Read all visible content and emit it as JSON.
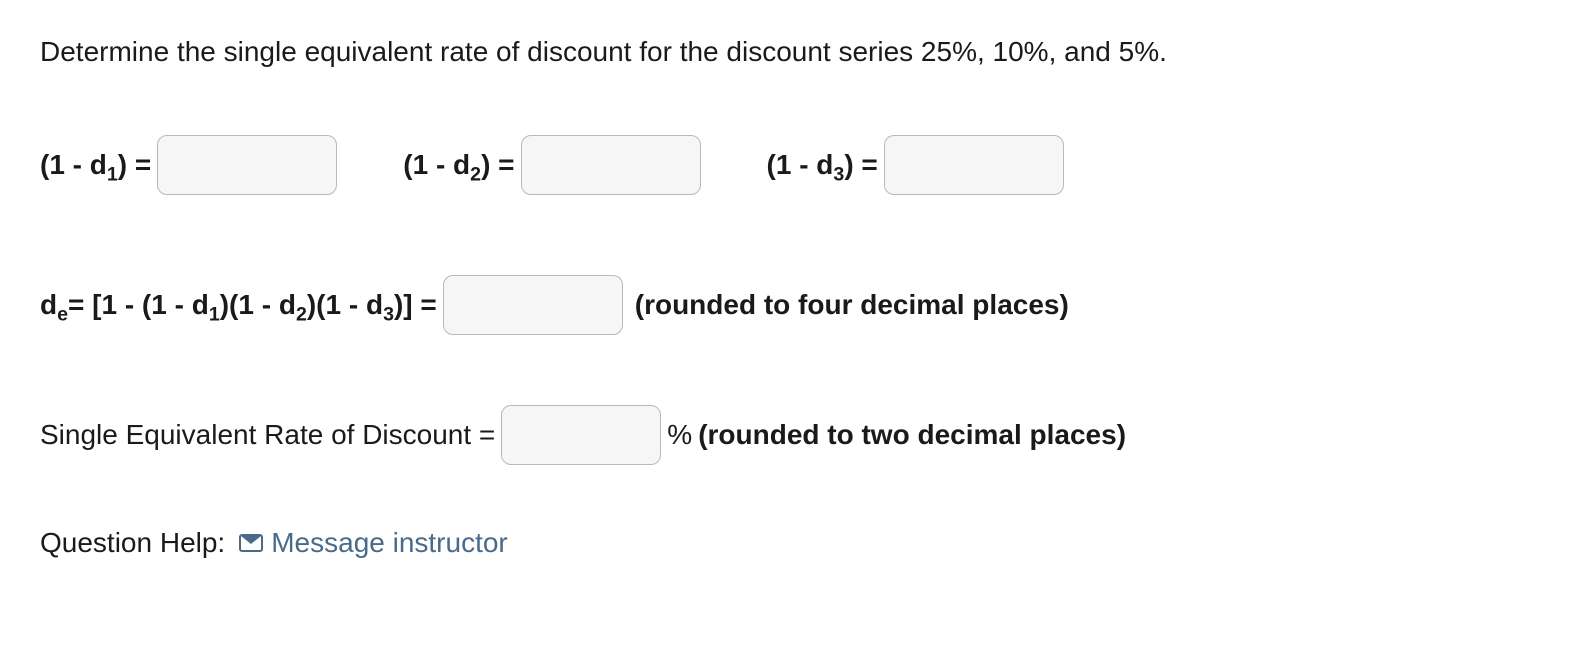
{
  "prompt": "Determine the single equivalent rate of discount for the discount series 25%, 10%, and 5%.",
  "row1": {
    "d1_label_pre": "(1 - d",
    "d1_sub": "1",
    "d1_label_post": ") = ",
    "d2_label_pre": "(1 - d",
    "d2_sub": "2",
    "d2_label_post": ") = ",
    "d3_label_pre": "(1 - d",
    "d3_sub": "3",
    "d3_label_post": ") = "
  },
  "row2": {
    "de_pre": "d",
    "de_sub": "e",
    "de_mid": "= [1 - (1 - d",
    "s1": "1",
    "p1": ")(1 - d",
    "s2": "2",
    "p2": ")(1 - d",
    "s3": "3",
    "p3": ")] = ",
    "note": "(rounded to four decimal places)"
  },
  "row3": {
    "label": "Single Equivalent Rate of Discount = ",
    "percent": "%",
    "note": " (rounded to two decimal places)"
  },
  "help": {
    "label": "Question Help:",
    "link": "Message instructor"
  },
  "inputs": {
    "d1": "",
    "d2": "",
    "d3": "",
    "de": "",
    "rate": ""
  }
}
